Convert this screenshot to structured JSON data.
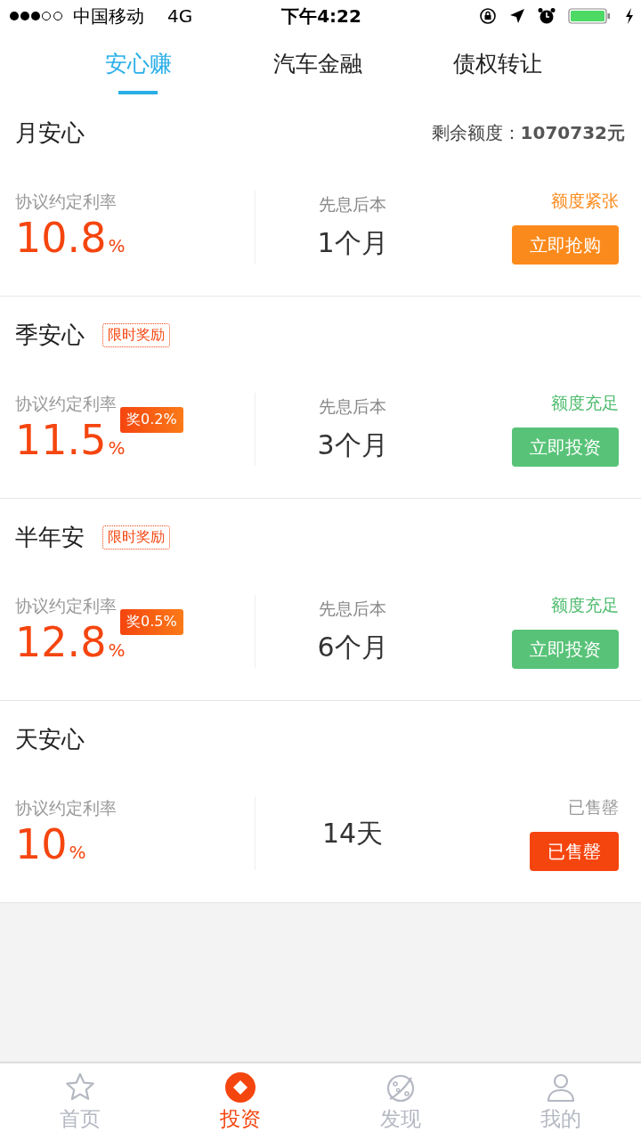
{
  "status_bar": {
    "carrier": "中国移动",
    "network": "4G",
    "time": "下午4:22"
  },
  "tabs": [
    {
      "label": "安心赚",
      "selected": true
    },
    {
      "label": "汽车金融",
      "selected": false
    },
    {
      "label": "债权转让",
      "selected": false
    }
  ],
  "header": {
    "quota_label": "剩余额度：",
    "quota_value": "1070732元"
  },
  "products": [
    {
      "name": "月安心",
      "rate_label": "协议约定利率",
      "rate": "10.8",
      "unit": "%",
      "repay_type": "先息后本",
      "term": "1个月",
      "status": "额度紧张",
      "kind": "tight",
      "action": "立即抢购"
    },
    {
      "name": "季安心",
      "tag": "限时奖励",
      "rate_label": "协议约定利率",
      "rate": "11.5",
      "unit": "%",
      "bonus": "奖0.2%",
      "repay_type": "先息后本",
      "term": "3个月",
      "status": "额度充足",
      "kind": "ample",
      "action": "立即投资"
    },
    {
      "name": "半年安",
      "tag": "限时奖励",
      "rate_label": "协议约定利率",
      "rate": "12.8",
      "unit": "%",
      "bonus": "奖0.5%",
      "repay_type": "先息后本",
      "term": "6个月",
      "status": "额度充足",
      "kind": "ample",
      "action": "立即投资"
    },
    {
      "name": "天安心",
      "rate_label": "协议约定利率",
      "rate": "10",
      "unit": "%",
      "term": "14天",
      "status": "已售罄",
      "kind": "soldout",
      "action": "已售罄"
    }
  ],
  "bottom_nav": [
    {
      "label": "首页",
      "selected": false
    },
    {
      "label": "投资",
      "selected": true
    },
    {
      "label": "发现",
      "selected": false
    },
    {
      "label": "我的",
      "selected": false
    }
  ]
}
